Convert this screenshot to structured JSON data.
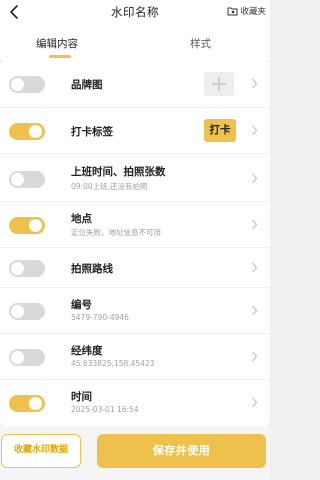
{
  "header": {
    "title": "水印名称",
    "favorite_label": "收藏夹"
  },
  "tabs": [
    {
      "label": "编辑内容"
    },
    {
      "label": "样式"
    }
  ],
  "items": [
    {
      "label": "品牌图",
      "enabled": false
    },
    {
      "label": "打卡标签",
      "enabled": true,
      "tag": "打卡"
    },
    {
      "label": "上班时间、拍照张数",
      "sub": "09:00上班,还没有拍照",
      "enabled": false
    },
    {
      "label": "地点",
      "sub": "定位失败，地址信息不可用",
      "enabled": true
    },
    {
      "label": "拍照路线",
      "enabled": false
    },
    {
      "label": "编号",
      "sub": "5479-790-4946",
      "enabled": false
    },
    {
      "label": "经纬度",
      "sub": "45.633825,158.45423",
      "enabled": false
    },
    {
      "label": "时间",
      "sub": "2025-03-01 16:54",
      "enabled": true
    }
  ],
  "footer": {
    "save_data_label": "收藏水印数据",
    "save_use_label": "保存并使用"
  },
  "colors": {
    "accent": "#eec14c",
    "toggle_off": "#d9d9d9"
  }
}
